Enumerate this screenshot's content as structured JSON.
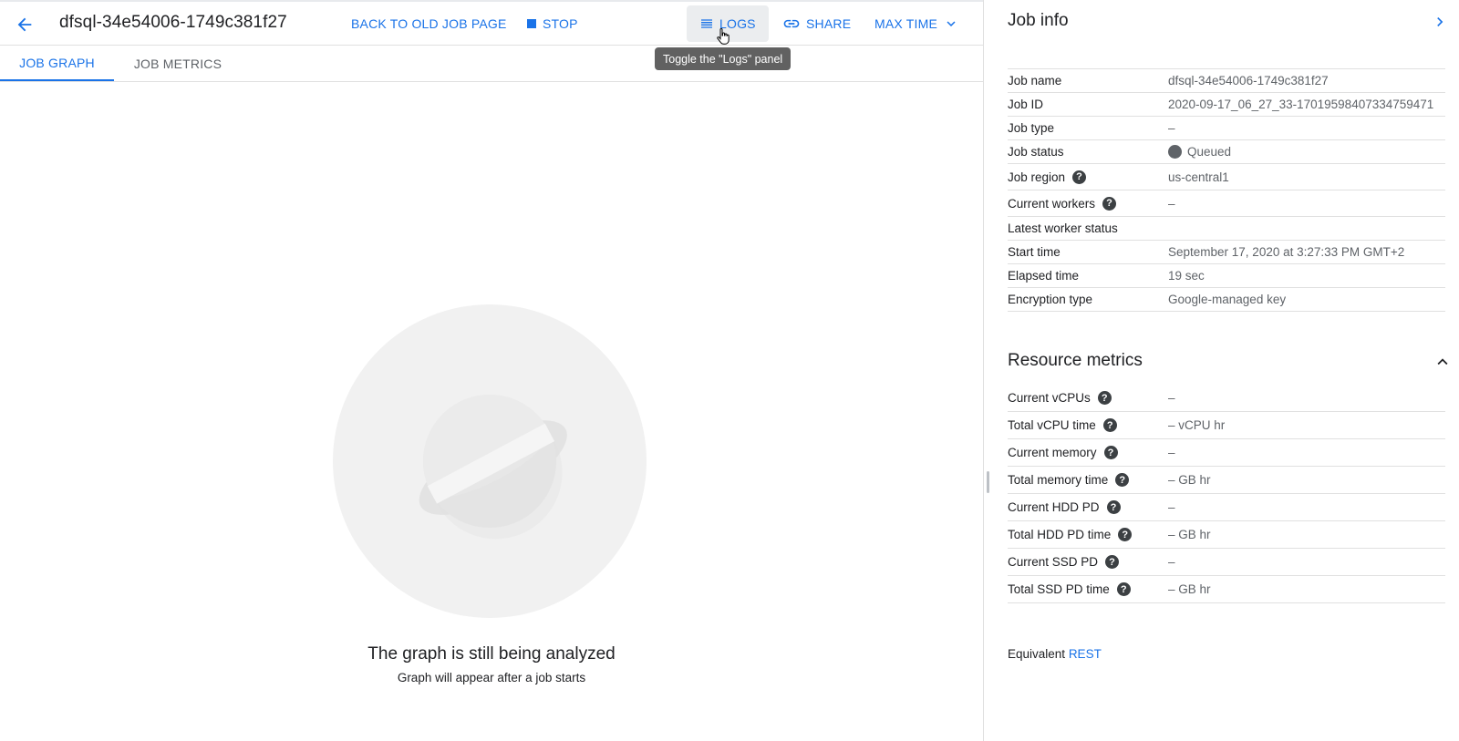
{
  "header": {
    "title": "dfsql-34e54006-1749c381f27",
    "back_old_label": "BACK TO OLD JOB PAGE",
    "stop_label": "STOP",
    "logs_label": "LOGS",
    "share_label": "SHARE",
    "max_time_label": "MAX TIME",
    "tooltip": "Toggle the \"Logs\" panel"
  },
  "tabs": [
    {
      "label": "JOB GRAPH",
      "active": true
    },
    {
      "label": "JOB METRICS",
      "active": false
    }
  ],
  "empty_state": {
    "title": "The graph is still being analyzed",
    "subtitle": "Graph will appear after a job starts"
  },
  "panel": {
    "title": "Job info",
    "job_info": [
      {
        "label": "Job name",
        "value": "dfsql-34e54006-1749c381f27"
      },
      {
        "label": "Job ID",
        "value": "2020-09-17_06_27_33-17019598407334759471"
      },
      {
        "label": "Job type",
        "value": "–"
      },
      {
        "label": "Job status",
        "value": "Queued"
      },
      {
        "label": "Job region",
        "value": "us-central1"
      },
      {
        "label": "Current workers",
        "value": "–"
      },
      {
        "label": "Latest worker status",
        "value": ""
      },
      {
        "label": "Start time",
        "value": "September 17, 2020 at 3:27:33 PM GMT+2"
      },
      {
        "label": "Elapsed time",
        "value": "19 sec"
      },
      {
        "label": "Encryption type",
        "value": "Google-managed key"
      }
    ],
    "resource_title": "Resource metrics",
    "resource_metrics": [
      {
        "label": "Current vCPUs",
        "value": "–"
      },
      {
        "label": "Total vCPU time",
        "value": "– vCPU hr"
      },
      {
        "label": "Current memory",
        "value": "–"
      },
      {
        "label": "Total memory time",
        "value": "– GB hr"
      },
      {
        "label": "Current HDD PD",
        "value": "–"
      },
      {
        "label": "Total HDD PD time",
        "value": "– GB hr"
      },
      {
        "label": "Current SSD PD",
        "value": "–"
      },
      {
        "label": "Total SSD PD time",
        "value": "– GB hr"
      }
    ],
    "equivalent_label": "Equivalent",
    "rest_link": "REST"
  },
  "colors": {
    "accent": "#1a73e8",
    "status_queued": "#5f6368",
    "art_bg": "#f1f1f1"
  }
}
